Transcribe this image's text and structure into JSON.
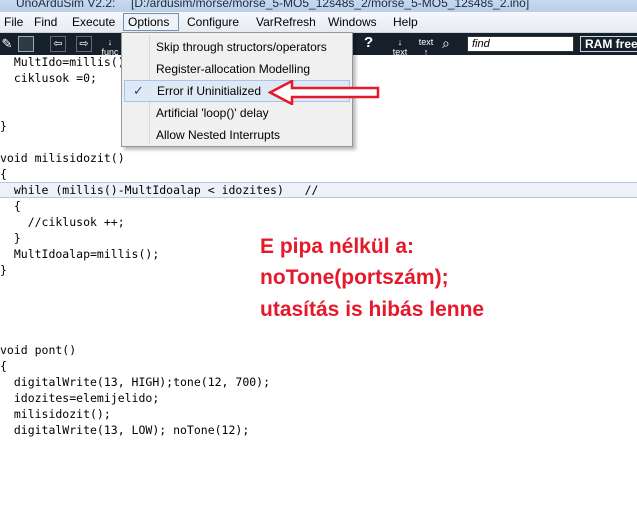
{
  "window": {
    "app_title": "UnoArduSim V2.2:",
    "path": "[D:/ardusim/morse/morse_5-MO5_12s48s_2/morse_5-MO5_12s48s_2.ino]"
  },
  "menubar": {
    "items": [
      "File",
      "Find",
      "Execute",
      "Options",
      "Configure",
      "VarRefresh",
      "Windows",
      "Help"
    ],
    "open_item": "Options"
  },
  "toolbar": {
    "func_label": "func",
    "text_label_1": "text",
    "text_label_2": "text",
    "help_symbol": "?",
    "find_placeholder": "find",
    "ram_label": "RAM free"
  },
  "options_menu": {
    "items": [
      {
        "label": "Skip through structors/operators",
        "checked": false
      },
      {
        "label": "Register-allocation Modelling",
        "checked": false
      },
      {
        "label": "Error if Uninitialized",
        "checked": true
      },
      {
        "label": "Artificial 'loop()' delay",
        "checked": false
      },
      {
        "label": "Allow Nested Interrupts",
        "checked": false
      }
    ],
    "check_symbol": "✓"
  },
  "code_lines": [
    "  MultIdo=millis();",
    "  ciklusok =0;",
    "",
    "",
    "}",
    "",
    "void milisidozit()",
    "{",
    "  while (millis()-MultIdoalap < idozites)   //",
    "  {",
    "    //ciklusok ++;",
    "  }",
    "  MultIdoalap=millis();",
    "}",
    "",
    "",
    "",
    "",
    "void pont()",
    "{",
    "  digitalWrite(13, HIGH);tone(12, 700);",
    "  idozites=elemijelido;",
    "  milisidozit();",
    "  digitalWrite(13, LOW); noTone(12);"
  ],
  "annotation": {
    "lines": [
      "E pipa nélkül a:",
      "noTone(portszám);",
      "utasítás is hibás lenne"
    ],
    "color": "#e5192b"
  }
}
